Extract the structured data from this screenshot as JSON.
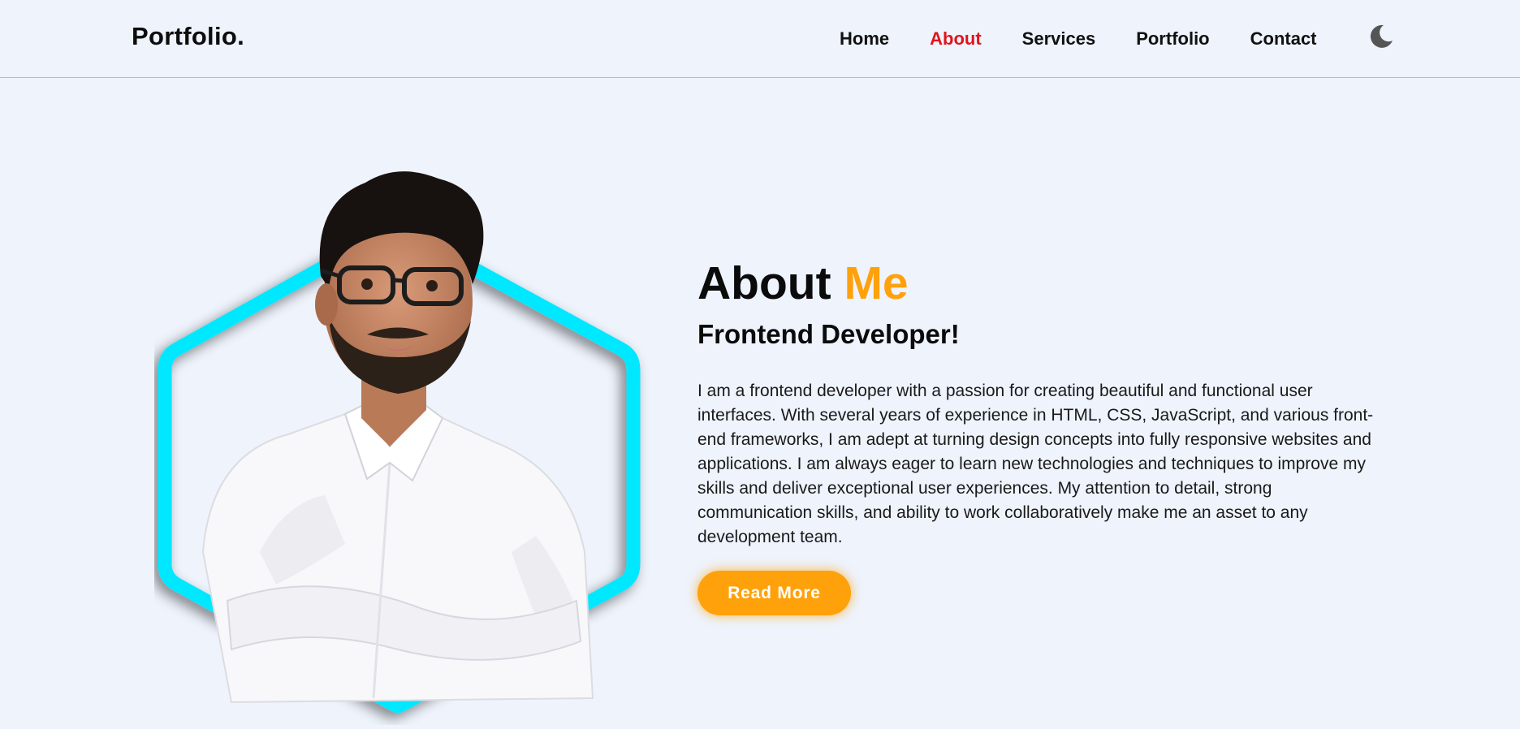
{
  "header": {
    "logo": "Portfolio.",
    "nav": [
      {
        "label": "Home"
      },
      {
        "label": "About"
      },
      {
        "label": "Services"
      },
      {
        "label": "Portfolio"
      },
      {
        "label": "Contact"
      }
    ],
    "active_nav": "About",
    "theme_toggle_icon": "moon-icon"
  },
  "about": {
    "title_main": "About",
    "title_accent": "Me",
    "subtitle": "Frontend Developer!",
    "bio": "I am a frontend developer with a passion for creating beautiful and functional user interfaces. With several years of experience in HTML, CSS, JavaScript, and various front-end frameworks, I am adept at turning design concepts into fully responsive websites and applications. I am always eager to learn new technologies and techniques to improve my skills and deliver exceptional user experiences. My attention to detail, strong communication skills, and ability to work collaboratively make me an asset to any development team.",
    "button_label": "Read More"
  },
  "colors": {
    "accent_orange": "#ffa10a",
    "active_red": "#e0151b",
    "hex_cyan": "#00e8ff",
    "background": "#eef3fc"
  }
}
